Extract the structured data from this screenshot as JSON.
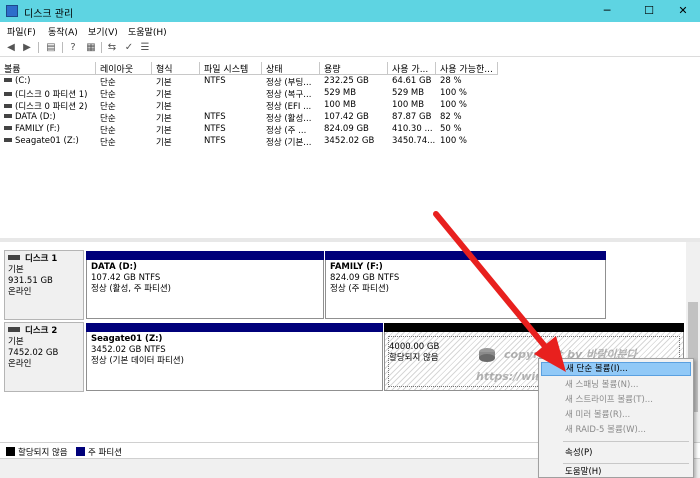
{
  "window": {
    "title": "디스크 관리",
    "min_glyph": "─",
    "max_glyph": "☐",
    "close_glyph": "✕"
  },
  "menu": [
    {
      "label": "파일(F)"
    },
    {
      "label": "동작(A)"
    },
    {
      "label": "보기(V)"
    },
    {
      "label": "도움말(H)"
    }
  ],
  "toolbar_icons": [
    "back-icon",
    "forward-icon",
    "properties-icon",
    "help-icon",
    "help-topics-icon",
    "refresh-icon",
    "check-icon",
    "list-icon"
  ],
  "volume_table": {
    "headers": [
      "볼륨",
      "레이아웃",
      "형식",
      "파일 시스템",
      "상태",
      "용량",
      "사용 가...",
      "사용 가능한..."
    ],
    "rows": [
      [
        "(C:)",
        "단순",
        "기본",
        "NTFS",
        "정상 (부팅...",
        "232.25 GB",
        "64.61 GB",
        "28 %"
      ],
      [
        "(디스크 0 파티션 1)",
        "단순",
        "기본",
        "",
        "정상 (복구...",
        "529 MB",
        "529 MB",
        "100 %"
      ],
      [
        "(디스크 0 파티션 2)",
        "단순",
        "기본",
        "",
        "정상 (EFI ...",
        "100 MB",
        "100 MB",
        "100 %"
      ],
      [
        "DATA (D:)",
        "단순",
        "기본",
        "NTFS",
        "정상 (활성...",
        "107.42 GB",
        "87.87 GB",
        "82 %"
      ],
      [
        "FAMILY (F:)",
        "단순",
        "기본",
        "NTFS",
        "정상 (주 ...",
        "824.09 GB",
        "410.30 ...",
        "50 %"
      ],
      [
        "Seagate01 (Z:)",
        "단순",
        "기본",
        "NTFS",
        "정상 (기본...",
        "3452.02 GB",
        "3450.74...",
        "100 %"
      ]
    ]
  },
  "disks": [
    {
      "name": "디스크 1",
      "type": "기본",
      "size": "931.51 GB",
      "status": "온라인",
      "partitions": [
        {
          "name": "DATA (D:)",
          "detail": "107.42 GB NTFS",
          "status": "정상 (활성, 주 파티션)"
        },
        {
          "name": "FAMILY (F:)",
          "detail": "824.09 GB NTFS",
          "status": "정상 (주 파티션)"
        }
      ]
    },
    {
      "name": "디스크 2",
      "type": "기본",
      "size": "7452.02 GB",
      "status": "온라인",
      "partitions": [
        {
          "name": "Seagate01 (Z:)",
          "detail": "3452.02 GB NTFS",
          "status": "정상 (기본 데이터 파티션)"
        },
        {
          "name": "",
          "detail": "4000.00 GB",
          "status": "할당되지 않음"
        }
      ]
    }
  ],
  "legend": [
    {
      "label": "할당되지 않음",
      "color": "#000000"
    },
    {
      "label": "주 파티션",
      "color": "#00007a"
    }
  ],
  "context_menu": [
    {
      "label": "새 단순 볼륨(I)...",
      "enabled": true
    },
    {
      "label": "새 스패닝 볼륨(N)...",
      "enabled": false
    },
    {
      "label": "새 스트라이프 볼륨(T)...",
      "enabled": false
    },
    {
      "label": "새 미러 볼륨(R)...",
      "enabled": false
    },
    {
      "label": "새 RAID-5 볼륨(W)...",
      "enabled": false
    },
    {
      "label": "속성(P)",
      "enabled": true
    },
    {
      "label": "도움말(H)",
      "enabled": true
    }
  ],
  "watermark": {
    "line1": "copyright by 바람이분다",
    "line2": "https://windy.tistory.com"
  },
  "colors": {
    "titlebar": "#5ed4e2",
    "primary_partition": "#00007a",
    "unallocated": "#000000",
    "menu_highlight": "#91c9f7",
    "arrow": "#e8201e"
  }
}
